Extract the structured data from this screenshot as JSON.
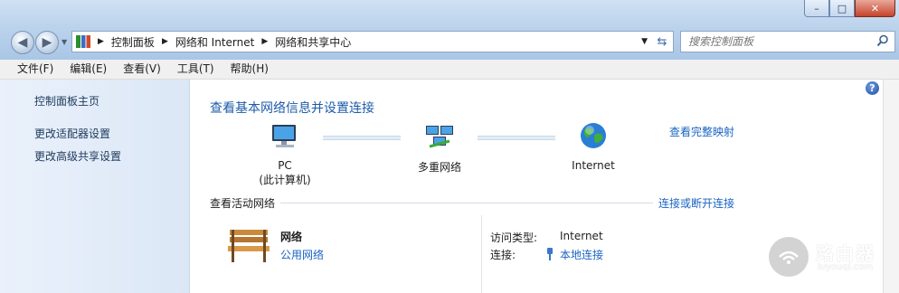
{
  "window": {
    "controls": {
      "minimize": "–",
      "maximize": "□",
      "close": "✕"
    }
  },
  "nav": {
    "back_icon": "back-arrow-icon",
    "forward_icon": "forward-arrow-icon",
    "breadcrumbs": [
      "控制面板",
      "网络和 Internet",
      "网络和共享中心"
    ],
    "search_placeholder": "搜索控制面板"
  },
  "menu": [
    "文件(F)",
    "编辑(E)",
    "查看(V)",
    "工具(T)",
    "帮助(H)"
  ],
  "sidebar": {
    "items": [
      {
        "label": "控制面板主页"
      },
      {
        "label": "更改适配器设置"
      },
      {
        "label": "更改高级共享设置"
      }
    ]
  },
  "main": {
    "title": "查看基本网络信息并设置连接",
    "full_map_link": "查看完整映射",
    "nodes": [
      {
        "label_line1": "PC",
        "label_line2": "(此计算机)",
        "icon": "computer-icon"
      },
      {
        "label_line1": "多重网络",
        "icon": "multiple-networks-icon"
      },
      {
        "label_line1": "Internet",
        "icon": "globe-icon"
      }
    ],
    "active_section_title": "查看活动网络",
    "connect_link": "连接或断开连接",
    "network": {
      "name": "网络",
      "type": "公用网络",
      "access_type_label": "访问类型:",
      "access_type_value": "Internet",
      "connection_label": "连接:",
      "connection_value": "本地连接"
    }
  },
  "watermark": {
    "text": "路由器",
    "sub": "luyouqi.com"
  },
  "colors": {
    "link": "#1a64c2",
    "title": "#1e5ba8",
    "sidebar_bg": "#e2ecf8"
  }
}
